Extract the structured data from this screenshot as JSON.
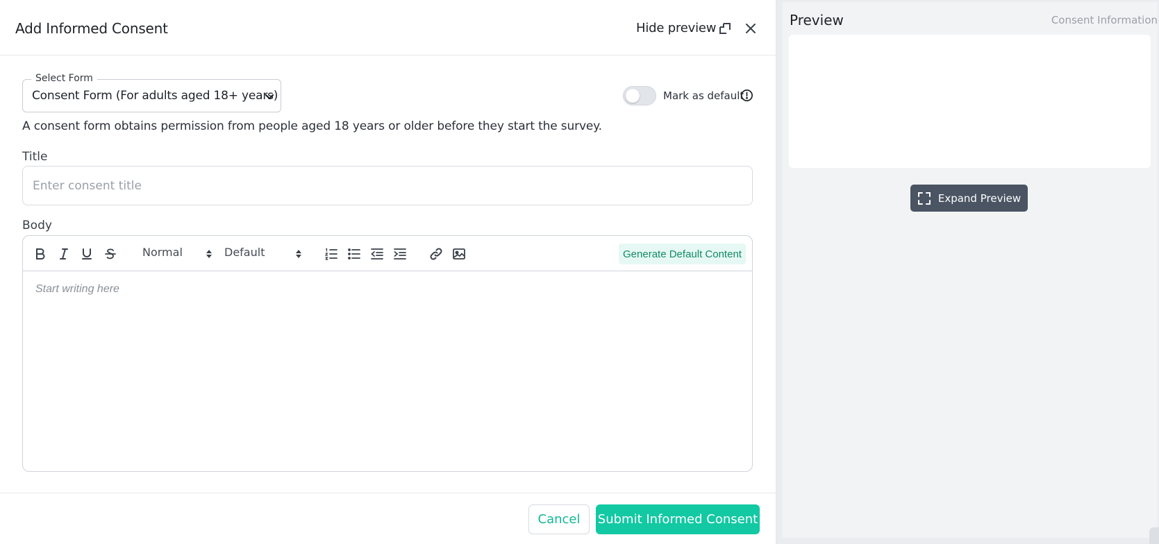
{
  "modal": {
    "title": "Add Informed Consent",
    "hide_preview_label": "Hide preview"
  },
  "select_form": {
    "label": "Select Form",
    "value": "Consent Form (For adults aged 18+ years)"
  },
  "mark_default": {
    "label": "Mark as default",
    "enabled": false
  },
  "description": "A consent form obtains permission from people aged 18 years or older before they start the survey.",
  "title_field": {
    "label": "Title",
    "placeholder": "Enter consent title",
    "value": ""
  },
  "body_field": {
    "label": "Body",
    "placeholder": "Start writing here",
    "toolbar": {
      "format_select": "Normal",
      "font_select": "Default",
      "generate_label": "Generate Default Content",
      "buttons": [
        "bold-icon",
        "italic-icon",
        "underline-icon",
        "strikethrough-icon",
        "ordered-list-icon",
        "bullet-list-icon",
        "outdent-icon",
        "indent-icon",
        "link-icon",
        "image-icon"
      ]
    }
  },
  "footer": {
    "cancel_label": "Cancel",
    "submit_label": "Submit Informed Consent"
  },
  "preview": {
    "title": "Preview",
    "subtitle": "Consent Information",
    "expand_label": "Expand Preview"
  },
  "colors": {
    "accent": "#12c9a3",
    "accent_text": "#12b895",
    "generate_bg": "#e6f8f3",
    "generate_text": "#128a69",
    "expand_bg": "#4a5463",
    "panel_bg": "#eaecef"
  }
}
